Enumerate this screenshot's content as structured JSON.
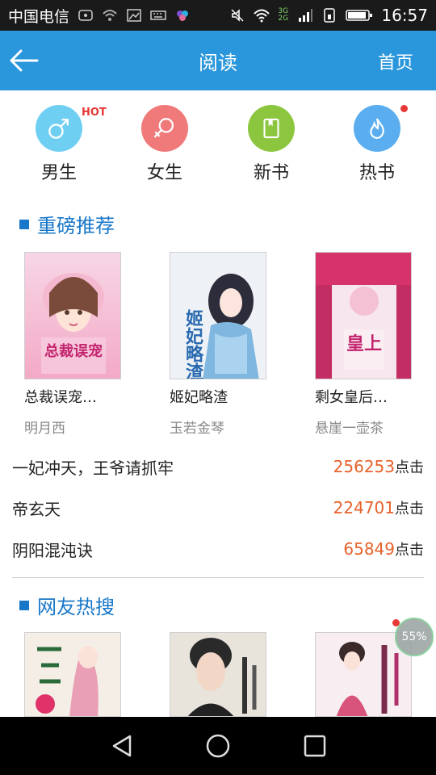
{
  "statusbar": {
    "carrier": "中国电信",
    "network_label": "3G 2G",
    "time": "16:57"
  },
  "header": {
    "title": "阅读",
    "home_label": "首页"
  },
  "categories": [
    {
      "label": "男生",
      "color": "#6fcff2",
      "icon": "male-icon"
    },
    {
      "label": "女生",
      "color": "#f07a7a",
      "icon": "female-icon"
    },
    {
      "label": "新书",
      "color": "#8cc63f",
      "icon": "book-icon"
    },
    {
      "label": "热书",
      "color": "#5aaef0",
      "icon": "flame-icon"
    }
  ],
  "hot_badge": "HOT",
  "recommend": {
    "title": "重磅推荐",
    "books": [
      {
        "name": "总裁误宠…",
        "author": "明月西",
        "cover_text": "总裁误宠"
      },
      {
        "name": "姬妃略渣",
        "author": "玉若金琴",
        "cover_text": "姬妃略渣"
      },
      {
        "name": "剩女皇后…",
        "author": "悬崖一壶茶",
        "cover_text": "皇上"
      }
    ]
  },
  "ranking": [
    {
      "name": "一妃冲天，王爷请抓牢",
      "count": "256253",
      "unit": "点击"
    },
    {
      "name": "帝玄天",
      "count": "224701",
      "unit": "点击"
    },
    {
      "name": "阴阳混沌诀",
      "count": "65849",
      "unit": "点击"
    }
  ],
  "hotsearch": {
    "title": "网友热搜"
  },
  "float_badge": "55%",
  "colors": {
    "accent": "#2a96dc",
    "section_blue": "#1877c9",
    "count_orange": "#e6622b"
  }
}
